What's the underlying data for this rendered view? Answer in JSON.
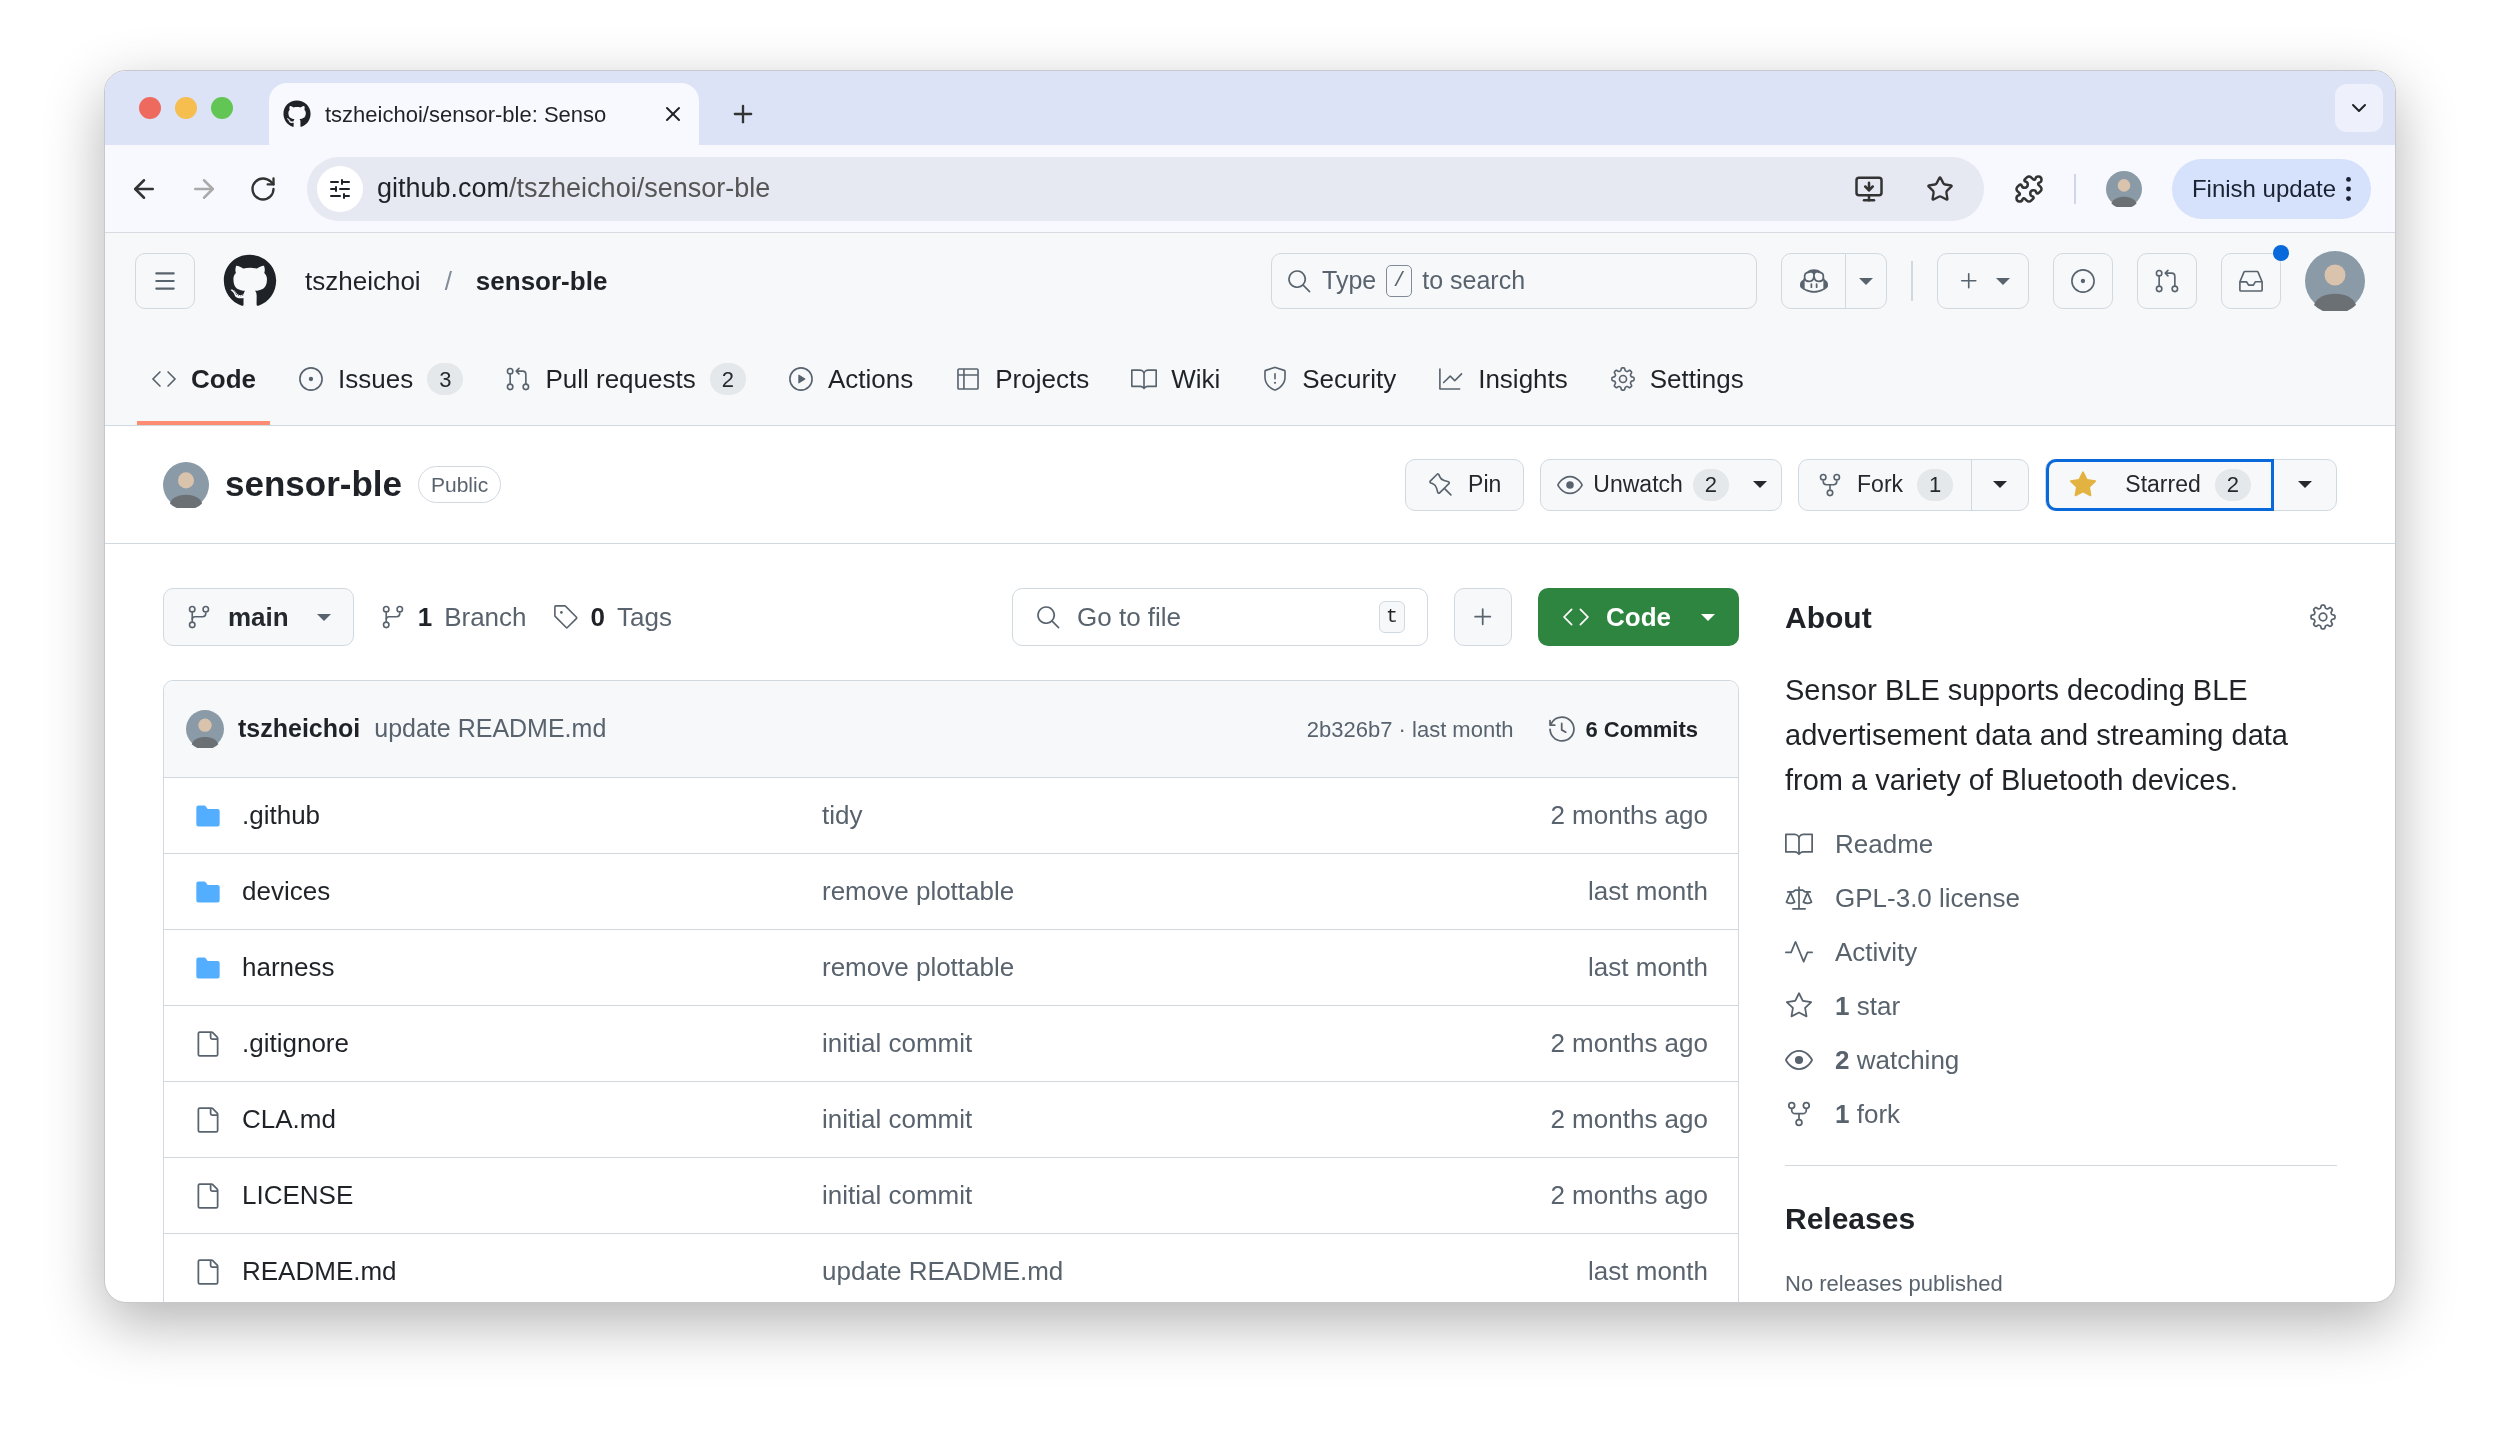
{
  "browser": {
    "tab_title": "tszheichoi/sensor-ble: Senso",
    "url_host": "github.com",
    "url_path": "/tszheichoi/sensor-ble",
    "update_button": "Finish update"
  },
  "header": {
    "owner": "tszheichoi",
    "separator": "/",
    "repo": "sensor-ble",
    "search": {
      "before": "Type",
      "key": "/",
      "after": "to search"
    },
    "inbox_unread": true
  },
  "nav_tabs": [
    {
      "label": "Code",
      "selected": true
    },
    {
      "label": "Issues",
      "count": "3",
      "selected": false
    },
    {
      "label": "Pull requests",
      "count": "2",
      "selected": false
    },
    {
      "label": "Actions",
      "selected": false
    },
    {
      "label": "Projects",
      "selected": false
    },
    {
      "label": "Wiki",
      "selected": false
    },
    {
      "label": "Security",
      "selected": false
    },
    {
      "label": "Insights",
      "selected": false
    },
    {
      "label": "Settings",
      "selected": false
    }
  ],
  "repo": {
    "name": "sensor-ble",
    "visibility": "Public",
    "pin": "Pin",
    "watch": {
      "label": "Unwatch",
      "count": "2"
    },
    "fork": {
      "label": "Fork",
      "count": "1"
    },
    "star": {
      "label": "Starred",
      "count": "2",
      "starred": true
    }
  },
  "toolbar": {
    "branch": "main",
    "branches": {
      "count": "1",
      "label": "Branch"
    },
    "tags": {
      "count": "0",
      "label": "Tags"
    },
    "go_to_file": {
      "placeholder": "Go to file",
      "key": "t"
    },
    "code_button": "Code"
  },
  "latest_commit": {
    "author": "tszheichoi",
    "message": "update README.md",
    "hash_time": "2b326b7 · last month",
    "commits": "6 Commits"
  },
  "files": [
    {
      "kind": "folder",
      "name": ".github",
      "message": "tidy",
      "time": "2 months ago"
    },
    {
      "kind": "folder",
      "name": "devices",
      "message": "remove plottable",
      "time": "last month"
    },
    {
      "kind": "folder",
      "name": "harness",
      "message": "remove plottable",
      "time": "last month"
    },
    {
      "kind": "file",
      "name": ".gitignore",
      "message": "initial commit",
      "time": "2 months ago"
    },
    {
      "kind": "file",
      "name": "CLA.md",
      "message": "initial commit",
      "time": "2 months ago"
    },
    {
      "kind": "file",
      "name": "LICENSE",
      "message": "initial commit",
      "time": "2 months ago"
    },
    {
      "kind": "file",
      "name": "README.md",
      "message": "update README.md",
      "time": "last month"
    }
  ],
  "about": {
    "title": "About",
    "description": "Sensor BLE supports decoding BLE advertisement data and streaming data from a variety of Bluetooth devices.",
    "links": [
      {
        "text": "Readme"
      },
      {
        "text": "GPL-3.0 license"
      },
      {
        "text": "Activity"
      },
      {
        "text": "**1** star"
      },
      {
        "text": "**2** watching"
      },
      {
        "text": "**1** fork"
      }
    ]
  },
  "releases": {
    "title": "Releases",
    "note": "No releases published"
  }
}
